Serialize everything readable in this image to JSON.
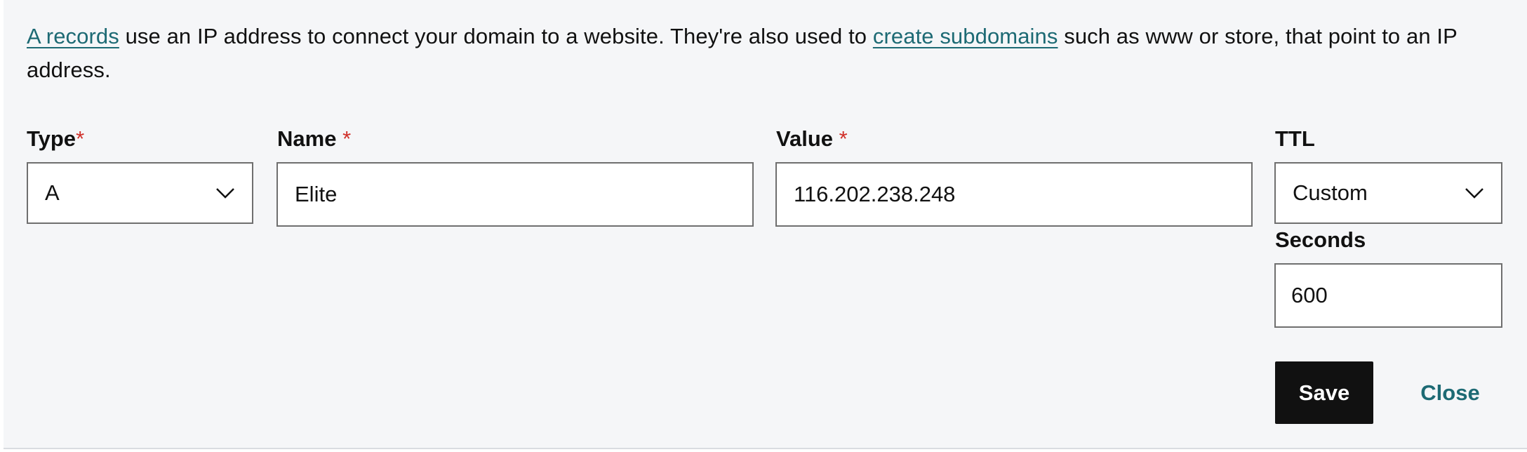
{
  "intro": {
    "link_a_records": "A records",
    "text_1": " use an IP address to connect your domain to a website. They're also used to ",
    "link_create_subdomains": "create subdomains",
    "text_2": " such as www or store, that point to an IP address."
  },
  "form": {
    "type": {
      "label": "Type",
      "required_mark": "*",
      "value": "A"
    },
    "name": {
      "label": "Name",
      "required_mark": "*",
      "value": "Elite"
    },
    "value": {
      "label": "Value",
      "required_mark": "*",
      "value": "116.202.238.248"
    },
    "ttl": {
      "label": "TTL",
      "value": "Custom"
    },
    "seconds": {
      "label": "Seconds",
      "value": "600"
    }
  },
  "actions": {
    "save_label": "Save",
    "close_label": "Close"
  },
  "colors": {
    "link": "#1d6a74",
    "required": "#d0302a",
    "panel_bg": "#f5f6f8",
    "primary_button": "#111111"
  }
}
